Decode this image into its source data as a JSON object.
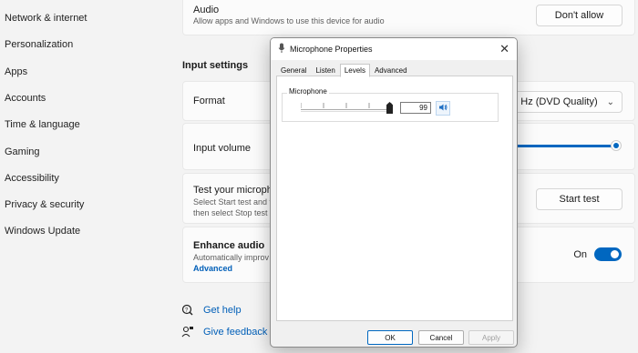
{
  "sidebar": {
    "items": [
      {
        "label": "Network & internet"
      },
      {
        "label": "Personalization"
      },
      {
        "label": "Apps"
      },
      {
        "label": "Accounts"
      },
      {
        "label": "Time & language"
      },
      {
        "label": "Gaming"
      },
      {
        "label": "Accessibility"
      },
      {
        "label": "Privacy & security"
      },
      {
        "label": "Windows Update"
      }
    ]
  },
  "audio_card": {
    "title": "Audio",
    "subtitle": "Allow apps and Windows to use this device for audio",
    "button": "Don't allow"
  },
  "input_settings": {
    "section_title": "Input settings",
    "format": {
      "label": "Format",
      "value": "00 Hz (DVD Quality)"
    },
    "volume": {
      "label": "Input volume",
      "level_fraction": 1.0
    },
    "test": {
      "title": "Test your micropho",
      "line1": "Select Start test and t",
      "line2": "then select Stop test",
      "button": "Start test"
    },
    "enhance": {
      "title": "Enhance audio",
      "subtitle": "Automatically improv",
      "link": "Advanced",
      "toggle_label": "On",
      "toggle_on": true
    }
  },
  "help": {
    "get_help": "Get help",
    "give_feedback": "Give feedback"
  },
  "dialog": {
    "title": "Microphone Properties",
    "tabs": [
      {
        "label": "General"
      },
      {
        "label": "Listen"
      },
      {
        "label": "Levels"
      },
      {
        "label": "Advanced"
      }
    ],
    "active_tab": "Levels",
    "group_label": "Microphone",
    "level_value": "99",
    "level_fraction": 0.99,
    "ok": "OK",
    "cancel": "Cancel",
    "apply": "Apply"
  },
  "colors": {
    "accent": "#0067c0",
    "link": "#005fb8"
  }
}
